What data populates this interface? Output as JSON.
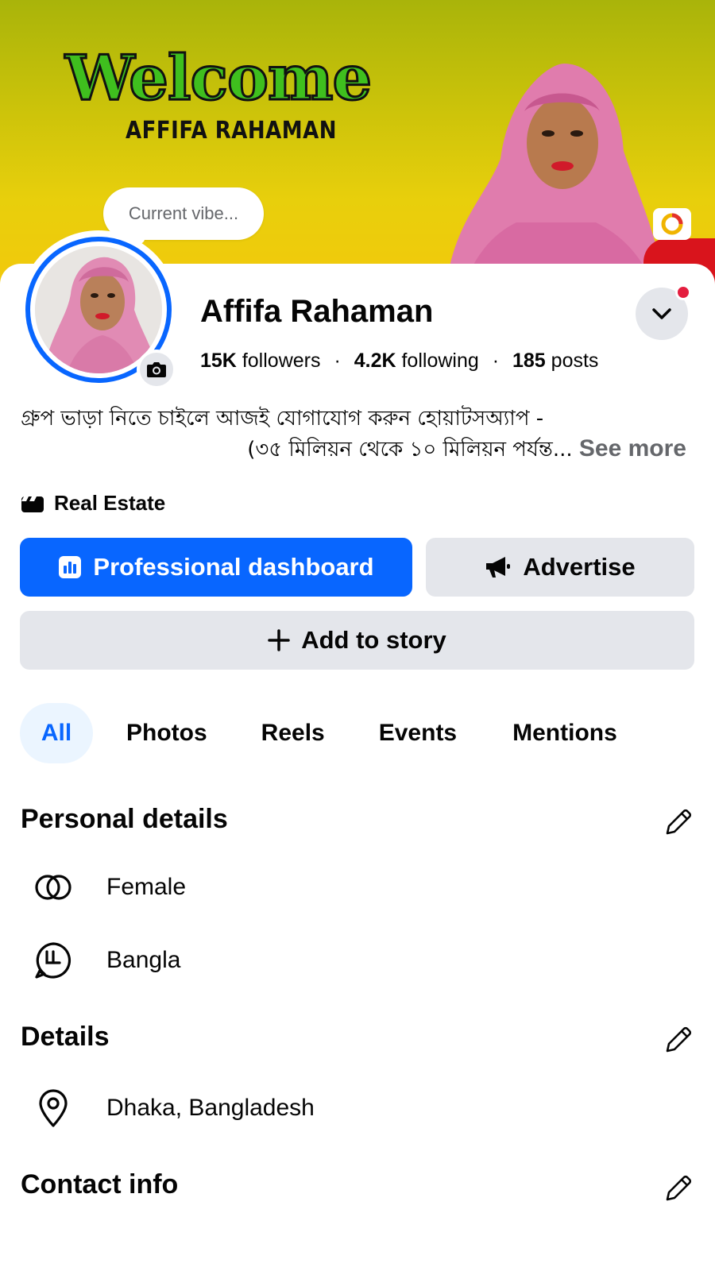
{
  "cover": {
    "welcome_text": "Welcome",
    "welcome_name": "AFFIFA RAHAMAN"
  },
  "vibe": {
    "placeholder": "Current vibe..."
  },
  "profile": {
    "name": "Affifa Rahaman",
    "followers_count": "15K",
    "followers_label": "followers",
    "following_count": "4.2K",
    "following_label": "following",
    "posts_count": "185",
    "posts_label": "posts",
    "separator": "·"
  },
  "bio": {
    "line1": "গ্রুপ ভাড়া নিতে চাইলে আজই যোগাযোগ করুন হোয়াটসঅ্যাপ -",
    "line2": "(৩৫ মিলিয়ন থেকে ১০ মিলিয়ন পর্যন্ত...",
    "see_more": "See more"
  },
  "category": {
    "label": "Real Estate",
    "icon": "clapperboard-icon"
  },
  "actions": {
    "dashboard_label": "Professional dashboard",
    "advertise_label": "Advertise",
    "add_story_label": "Add to story"
  },
  "tabs": [
    {
      "label": "All",
      "active": true
    },
    {
      "label": "Photos",
      "active": false
    },
    {
      "label": "Reels",
      "active": false
    },
    {
      "label": "Events",
      "active": false
    },
    {
      "label": "Mentions",
      "active": false
    }
  ],
  "personal_details": {
    "title": "Personal details",
    "items": [
      {
        "icon": "gender-icon",
        "text": "Female"
      },
      {
        "icon": "language-icon",
        "text": "Bangla"
      }
    ]
  },
  "details": {
    "title": "Details",
    "items": [
      {
        "icon": "location-pin-icon",
        "text": "Dhaka, Bangladesh"
      }
    ]
  },
  "contact_info": {
    "title": "Contact info"
  },
  "colors": {
    "accent": "#0866ff",
    "button_gray": "#e4e6eb",
    "secondary_text": "#65676b",
    "notification_red": "#e41e3f"
  }
}
